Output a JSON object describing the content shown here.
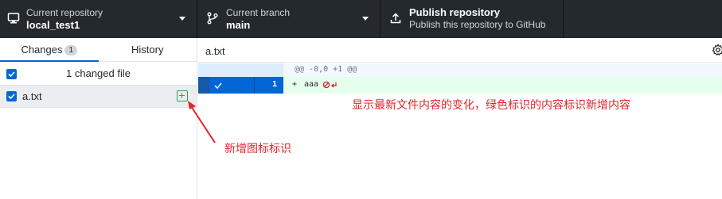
{
  "toolbar": {
    "repository": {
      "label": "Current repository",
      "value": "local_test1",
      "icon": "desktop-icon"
    },
    "branch": {
      "label": "Current branch",
      "value": "main",
      "icon": "git-branch-icon"
    },
    "publish": {
      "label": "Publish repository",
      "value": "Publish this repository to GitHub",
      "icon": "upload-icon"
    }
  },
  "sidebar": {
    "tabs": [
      {
        "label": "Changes",
        "count": "1",
        "active": true
      },
      {
        "label": "History",
        "active": false
      }
    ],
    "changed_header": "1 changed file",
    "files": [
      {
        "name": "a.txt",
        "status": "added",
        "checked": true
      }
    ]
  },
  "diff": {
    "file": "a.txt",
    "hunk": "@@ -0,0 +1 @@",
    "lines": [
      {
        "number": "1",
        "prefix": "+",
        "text": "aaa",
        "selected": true
      }
    ]
  },
  "annotations": {
    "diff_note": "显示最新文件内容的变化，绿色标识的内容标识新增内容",
    "icon_note": "新增图标标识"
  },
  "colors": {
    "toolbar_bg": "#24292e",
    "accent": "#0366d6",
    "added_green": "#28a745",
    "added_bg": "#e6ffed",
    "annotation_red": "#e3242b"
  }
}
